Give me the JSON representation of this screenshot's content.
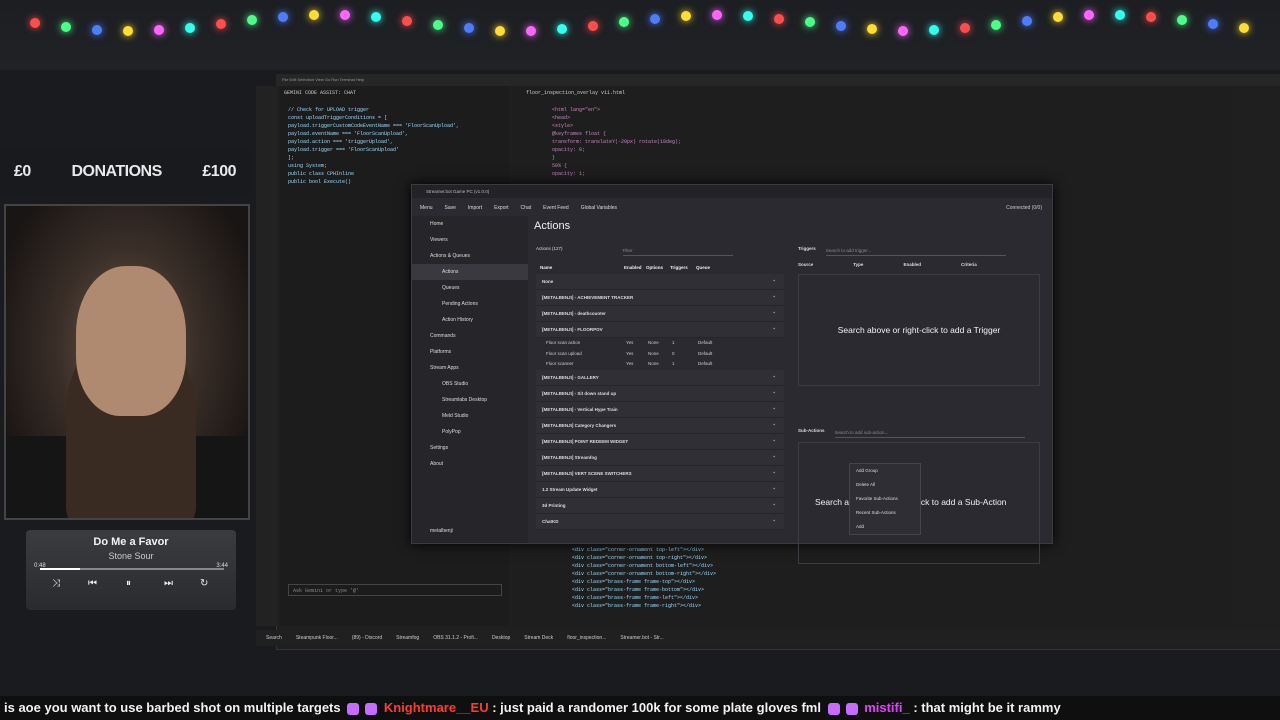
{
  "overlay": {
    "donations": {
      "left": "£0",
      "label": "DONATIONS",
      "right": "£100"
    },
    "now_playing": {
      "title": "Do Me a Favor",
      "artist": "Stone Sour",
      "elapsed": "0:48",
      "duration": "3:44",
      "progress": 0.22
    }
  },
  "ide": {
    "menu": [
      "File",
      "Edit",
      "Selection",
      "View",
      "Go",
      "Run",
      "Terminal",
      "Help"
    ],
    "chat_title": "GEMINI CODE ASSIST: CHAT",
    "tab": "floor_inspection_overlay v11.html",
    "chat_snippet": [
      "// Check for UPLOAD trigger",
      "const uploadTriggerConditions = [",
      "payload.triggerCustomCodeEventName === 'FloorScanUpload',",
      "payload.eventName === 'FloorScanUpload',",
      "payload.action === 'triggerUpload',",
      "payload.trigger === 'FloorScanUpload'",
      "];",
      "using System;",
      "public class CPHInline",
      "public bool Execute()"
    ],
    "chat_prompt_placeholder": "Ask Gemini or type '@'",
    "code_snippet": [
      "<html lang=\"en\">",
      "<head>",
      "<style>",
      "@keyframes float {",
      "transform: translateY(-20px) rotate(10deg);",
      "opacity: 0;",
      "}",
      "50% {",
      "opacity: 1;"
    ],
    "code_snippet_bottom": [
      "<div class=\"corner-ornament top-left\"></div>",
      "<div class=\"corner-ornament top-right\"></div>",
      "<div class=\"corner-ornament bottom-left\"></div>",
      "<div class=\"corner-ornament bottom-right\"></div>",
      "<div class=\"brass-frame frame-top\"></div>",
      "<div class=\"brass-frame frame-bottom\"></div>",
      "<div class=\"brass-frame frame-left\"></div>",
      "<div class=\"brass-frame frame-right\"></div>"
    ]
  },
  "taskbar": [
    "Search",
    "Steampunk Floor...",
    "(89) - Discord",
    "Streamfog",
    "OBS 31.1.2 - Profi...",
    "Desktop",
    "Stream Deck",
    "floor_inspection...",
    "Streamer.bot - Str..."
  ],
  "streamerbot": {
    "window_title": "Streamer.bot Game PC (v1.0.0)",
    "menu": [
      "Menu",
      "Save",
      "Import",
      "Export",
      "Chat",
      "Event Feed",
      "Global Variables"
    ],
    "connection": "Connected (0/0)",
    "nav": [
      {
        "label": "Home",
        "sub": false
      },
      {
        "label": "Viewers",
        "sub": false
      },
      {
        "label": "Actions & Queues",
        "sub": false
      },
      {
        "label": "Actions",
        "sub": true,
        "active": true
      },
      {
        "label": "Queues",
        "sub": true
      },
      {
        "label": "Pending Actions",
        "sub": true
      },
      {
        "label": "Action History",
        "sub": true
      },
      {
        "label": "Commands",
        "sub": false
      },
      {
        "label": "Platforms",
        "sub": false
      },
      {
        "label": "Stream Apps",
        "sub": false
      },
      {
        "label": "OBS Studio",
        "sub": true
      },
      {
        "label": "Streamlabs Desktop",
        "sub": true
      },
      {
        "label": "Meld Studio",
        "sub": true
      },
      {
        "label": "PolyPop",
        "sub": true
      },
      {
        "label": "Settings",
        "sub": false
      },
      {
        "label": "About",
        "sub": false
      }
    ],
    "user": "metalbenji",
    "page_title": "Actions",
    "actions_label": "Actions (127)",
    "filter_placeholder": "Filter",
    "columns": [
      "Name",
      "Enabled",
      "Options",
      "Triggers",
      "Queue"
    ],
    "groups_top": [
      "None",
      "[METALBENJI] - ACHIEVEMENT TRACKER",
      "[METALBENJI] - deathcounter",
      "[METALBENJI] - FLOORPOV"
    ],
    "rows": [
      [
        "Floor scan action",
        "Yes",
        "None",
        "1",
        "Default"
      ],
      [
        "Floor scan upload",
        "Yes",
        "None",
        "0",
        "Default"
      ],
      [
        "Floor scanner",
        "Yes",
        "None",
        "1",
        "Default"
      ]
    ],
    "groups_bottom": [
      "[METALBENJI] - GALLERY",
      "[METALBENJI] - Sit down stand up",
      "[METALBENJI] - Vertical Hype Train",
      "[METALBENJI] Category Changers",
      "[METALBENJI] POINT REDEEM WIDGET",
      "[METALBENJI] Streamfog",
      "[METALBENJI] VERT SCENE SWITCHERS",
      "1.2 Stream Update Widget",
      "3d Printing",
      "ChatKD"
    ],
    "triggers": {
      "title": "Triggers",
      "placeholder": "Search to add trigger...",
      "columns": [
        "Source",
        "Type",
        "Enabled",
        "Criteria"
      ],
      "empty": "Search above or right-click to add a Trigger"
    },
    "subactions": {
      "title": "Sub-Actions",
      "placeholder": "Search to add sub-action...",
      "empty_left": "Search a",
      "empty_right": "ick to add a Sub-Action"
    },
    "context_menu": [
      "Add Group",
      "Delete All",
      "Favorite Sub-Actions",
      "Recent Sub-Actions",
      "Add"
    ]
  },
  "ticker": {
    "msg1": "is aoe you want to use barbed shot on multiple targets",
    "user1": "Knightmare__EU",
    "msg2": ": just paid a randomer 100k for some plate gloves fml",
    "user2": "mistifi_",
    "msg3": ": that might be it rammy"
  },
  "colors": {
    "accent_user1": "#ff3b30",
    "accent_user2": "#e040fb"
  }
}
